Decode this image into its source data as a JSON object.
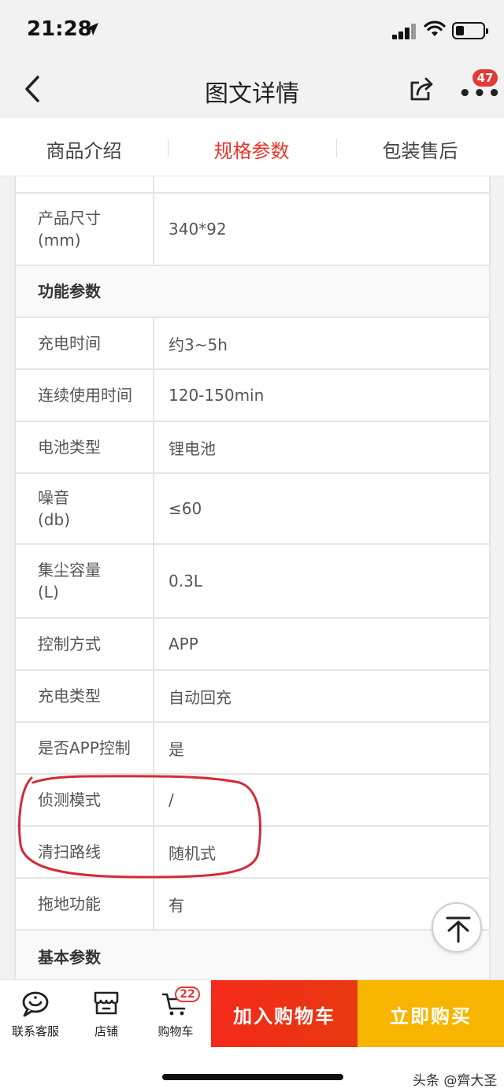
{
  "status": {
    "time": "21:28",
    "battery_level": 0.3
  },
  "nav": {
    "title": "图文详情",
    "badge": "47"
  },
  "tabs": [
    {
      "label": "商品介绍"
    },
    {
      "label": "规格参数"
    },
    {
      "label": "包装售后"
    }
  ],
  "table": {
    "rows": [
      {
        "key": "产品尺寸\n(mm)",
        "value": "340*92"
      },
      {
        "key": "功能参数",
        "value": ""
      },
      {
        "key": "充电时间",
        "value": "约3~5h"
      },
      {
        "key": "连续使用时间",
        "value": "120-150min"
      },
      {
        "key": "电池类型",
        "value": "锂电池"
      },
      {
        "key": "噪音\n(db)",
        "value": "≤60"
      },
      {
        "key": "集尘容量\n(L)",
        "value": "0.3L"
      },
      {
        "key": "控制方式",
        "value": "APP"
      },
      {
        "key": "充电类型",
        "value": "自动回充"
      },
      {
        "key": "是否APP控制",
        "value": "是"
      },
      {
        "key": "侦测模式",
        "value": "/"
      },
      {
        "key": "清扫路线",
        "value": "随机式"
      },
      {
        "key": "拖地功能",
        "value": "有"
      },
      {
        "key": "基本参数",
        "value": ""
      }
    ]
  },
  "bottom": {
    "service_label": "联系客服",
    "shop_label": "店铺",
    "cart_label": "购物车",
    "cart_count": "22",
    "add_cart_label": "加入购物车",
    "buy_now_label": "立即购买"
  },
  "watermark": "头条 @齊大圣",
  "colors": {
    "accent_red": "#e8352a",
    "buy_yellow": "#f7b500",
    "annotation_red": "#d42a3a"
  }
}
